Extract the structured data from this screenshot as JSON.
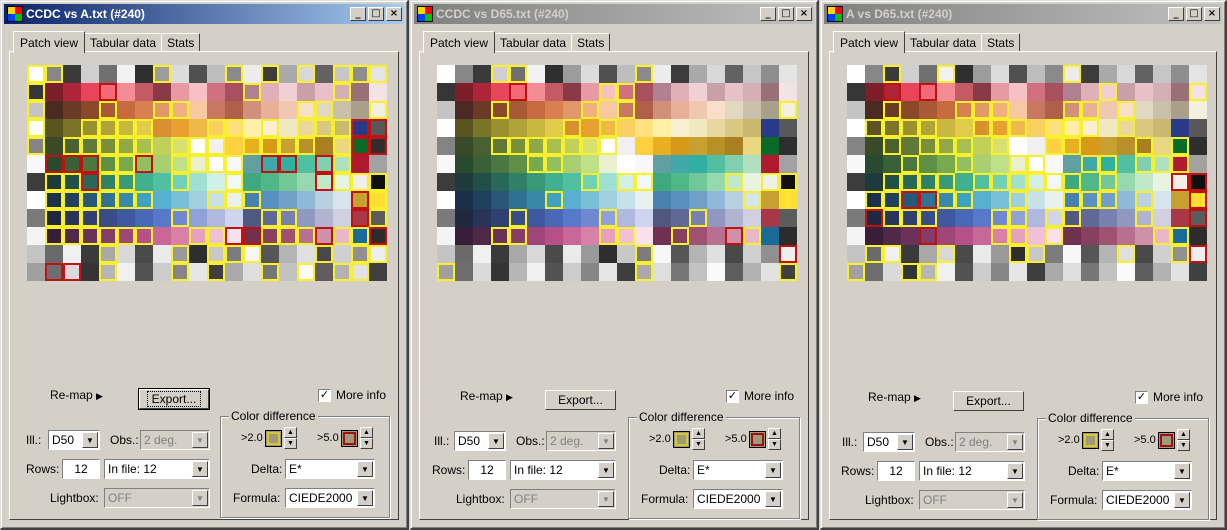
{
  "colors": {
    "patch_rows": [
      [
        "#ffffff",
        "#878787",
        "#3a3a3a",
        "#cfcfcf",
        "#6f6f6f",
        "#f2f2f2",
        "#2f2f2f",
        "#9c9c9c",
        "#dcdcdc",
        "#505050",
        "#bdbdbd",
        "#8a8a8a",
        "#ececec",
        "#3c3c3c",
        "#a9a9a9",
        "#d8d8d8",
        "#626262",
        "#c6c6c6",
        "#8e8e8e",
        "#e4e4e4"
      ],
      [
        "#363636",
        "#7b1e2a",
        "#b0243a",
        "#e8455a",
        "#f26a78",
        "#f48c94",
        "#c45a64",
        "#8a3a46",
        "#e89aa4",
        "#f7c0c4",
        "#d07080",
        "#a85060",
        "#b08090",
        "#e0b0b8",
        "#f0d0d4",
        "#c8a0a8",
        "#e8c0c8",
        "#d4b0b4",
        "#9a7078",
        "#f2e4e4"
      ],
      [
        "#c4c4c4",
        "#4a2a22",
        "#6a3a26",
        "#8a4a2a",
        "#a85a36",
        "#c86a40",
        "#d88050",
        "#e09868",
        "#f0b080",
        "#f8c8a0",
        "#c87860",
        "#b06048",
        "#d0907a",
        "#e8b098",
        "#f0c8b0",
        "#f8e0c8",
        "#e0d8c0",
        "#c8c0a8",
        "#a8a088",
        "#f4f0e0"
      ],
      [
        "#ffffff",
        "#5a5420",
        "#7a7428",
        "#9a9030",
        "#b0a438",
        "#c8b840",
        "#e0cc48",
        "#d89030",
        "#e8a030",
        "#f0b848",
        "#f8d060",
        "#ffe080",
        "#fff0a8",
        "#f8f0d0",
        "#f0e8c0",
        "#e8d8a0",
        "#d8c880",
        "#c8b870",
        "#2a3a8a",
        "#585858"
      ],
      [
        "#848484",
        "#3a4a28",
        "#4a6030",
        "#607838",
        "#78903e",
        "#90a848",
        "#a8c050",
        "#c0d058",
        "#d8e070",
        "#ffffff",
        "#f0f0f0",
        "#ffd040",
        "#e8b020",
        "#d89818",
        "#c8a030",
        "#b89028",
        "#a88020",
        "#e8d880",
        "#0a6a2a",
        "#2e2e2e"
      ],
      [
        "#f8f8f8",
        "#2a4a30",
        "#3a6038",
        "#4a7840",
        "#609048",
        "#78a850",
        "#90c060",
        "#a8d070",
        "#c0e088",
        "#e8f0d0",
        "#ffffff",
        "#f8f8f8",
        "#60a0a0",
        "#40a8a8",
        "#30b0a0",
        "#50c0a0",
        "#80d0b0",
        "#b0e0c0",
        "#b01a30",
        "#a2a2a2"
      ],
      [
        "#3c3c3c",
        "#1e3a3a",
        "#205048",
        "#286858",
        "#308068",
        "#389878",
        "#40b090",
        "#50c0a0",
        "#70d0b8",
        "#a0e0d0",
        "#d0f0e8",
        "#f0f8f8",
        "#40a880",
        "#50b888",
        "#70c898",
        "#98d8b0",
        "#c0e8c8",
        "#e8f4e0",
        "#f0f0e8",
        "#101010"
      ],
      [
        "#ffffff",
        "#1a3048",
        "#204060",
        "#285878",
        "#307090",
        "#3888a8",
        "#40a0c0",
        "#58b0d0",
        "#78c0d8",
        "#a0d0e0",
        "#c8e0e8",
        "#e8f0f0",
        "#4880b0",
        "#5890c0",
        "#70a0c8",
        "#90b8d8",
        "#b8d0e0",
        "#d8e4ec",
        "#c8a030",
        "#ffe030"
      ],
      [
        "#7a7a7a",
        "#202840",
        "#283458",
        "#304070",
        "#384c88",
        "#4058a0",
        "#4a68b8",
        "#5878c8",
        "#7088d0",
        "#90a0d8",
        "#b0b8e0",
        "#d0d4ec",
        "#505880",
        "#606898",
        "#7880b0",
        "#9098c0",
        "#b0b4d0",
        "#d0d0e0",
        "#a83848",
        "#5c5c5c"
      ],
      [
        "#f4f4f4",
        "#381e38",
        "#502848",
        "#6a3258",
        "#843c68",
        "#9e4678",
        "#b85088",
        "#c86898",
        "#d880a8",
        "#e8a0c0",
        "#f0c0d4",
        "#f8e0ec",
        "#703050",
        "#884060",
        "#a05070",
        "#b87090",
        "#d090a8",
        "#e8b8c8",
        "#1a6a9a",
        "#2c2c2c"
      ],
      [
        "#c4c4c4",
        "#6a6a6a",
        "#f0f0f0",
        "#3a3a3a",
        "#a8a8a8",
        "#d8d8d8",
        "#4a4a4a",
        "#eaeaea",
        "#9a9a9a",
        "#2e2e2e",
        "#c8c8c8",
        "#7c7c7c",
        "#f6f6f6",
        "#565656",
        "#b4b4b4",
        "#e0e0e0",
        "#484848",
        "#d0d0d0",
        "#909090",
        "#eeeeee"
      ],
      [
        "#a0a0a0",
        "#6e6e6e",
        "#dadada",
        "#343434",
        "#b6b6b6",
        "#f0f0f0",
        "#525252",
        "#cccccc",
        "#868686",
        "#e6e6e6",
        "#3e3e3e",
        "#aaaaaa",
        "#dedede",
        "#767676",
        "#c2c2c2",
        "#fafafa",
        "#5e5e5e",
        "#b2b2b2",
        "#e2e2e2",
        "#404040"
      ]
    ]
  },
  "windows": [
    {
      "title": "CCDC vs A.txt (#240)",
      "active": true,
      "tabs": [
        "Patch view",
        "Tabular data",
        "Stats"
      ],
      "remap_label": "Re-map",
      "export_label": "Export...",
      "more_info_label": "More info",
      "more_info_checked": "✓",
      "ill_label": "Ill.:",
      "ill_value": "D50",
      "obs_label": "Obs.:",
      "obs_value": "2 deg.",
      "rows_label": "Rows:",
      "rows_value": "12",
      "in_file_value": "In file: 12",
      "lightbox_label": "Lightbox:",
      "lightbox_value": "OFF",
      "color_diff_title": "Color difference",
      "gt2_label": ">2.0",
      "gt5_label": ">5.0",
      "delta_label": "Delta:",
      "delta_value": "E*",
      "formula_label": "Formula:",
      "formula_value": "CIEDE2000"
    },
    {
      "title": "CCDC vs D65.txt (#240)",
      "active": false,
      "tabs": [
        "Patch view",
        "Tabular data",
        "Stats"
      ],
      "remap_label": "Re-map",
      "export_label": "Export...",
      "more_info_label": "More info",
      "more_info_checked": "✓",
      "ill_label": "Ill.:",
      "ill_value": "D50",
      "obs_label": "Obs.:",
      "obs_value": "2 deg.",
      "rows_label": "Rows:",
      "rows_value": "12",
      "in_file_value": "In file: 12",
      "lightbox_label": "Lightbox:",
      "lightbox_value": "OFF",
      "color_diff_title": "Color difference",
      "gt2_label": ">2.0",
      "gt5_label": ">5.0",
      "delta_label": "Delta:",
      "delta_value": "E*",
      "formula_label": "Formula:",
      "formula_value": "CIEDE2000"
    },
    {
      "title": "A vs D65.txt (#240)",
      "active": false,
      "tabs": [
        "Patch view",
        "Tabular data",
        "Stats"
      ],
      "remap_label": "Re-map",
      "export_label": "Export...",
      "more_info_label": "More info",
      "more_info_checked": "✓",
      "ill_label": "Ill.:",
      "ill_value": "D50",
      "obs_label": "Obs.:",
      "obs_value": "2 deg.",
      "rows_label": "Rows:",
      "rows_value": "12",
      "in_file_value": "In file: 12",
      "lightbox_label": "Lightbox:",
      "lightbox_value": "OFF",
      "color_diff_title": "Color difference",
      "gt2_label": ">2.0",
      "gt5_label": ">5.0",
      "delta_label": "Delta:",
      "delta_value": "E*",
      "formula_label": "Formula:",
      "formula_value": "CIEDE2000"
    }
  ],
  "title_buttons": {
    "minimize": "_",
    "maximize": "□",
    "close": "×"
  },
  "highlights": [
    "yy.....y...y.y.y.yyy|y...r.......y....y..|y...y..yy......yy..y|y..yyyy...yy.y.yyyrr|y.yyyyy.yyy.yyyy.yrr|.rrryyr.yyyy.rr.ry..|.yyryy..y..y....ryyy|.yyyyyy...yyy.....ry|.yyy....y....yy...ry|.yyyyyy..yyrryyyryyr|....y...y.yyy...y.yy|.rr.y...y.y..y.y.yy.",
    "...yy......y........|....r....yy.........|...y....y.y........y|.......y.y..........|...yyyyyyy..........|.....yy.............|........y.yy....y.yy|......y..........y..|....y....y....y.....|...yy....yy..y..ry..|...........y.......r|y..........y.......y.",
    "..y..y......y.......|..r.r.........y....y|..y...yyy...yy.y....|.yyyy..yyy.yyy.y....|..y.yyy.y..yy...y.y.|...y..y..yy..yy.yyy.|..yyyy.yyyyyy.y...rr|.yyrryy..y..yyy.y..r|.ryyy...yy.yy...y..r|....r...yy.y.....yy.|.yy..y...yy....y..yr|y..yy...............",
    "...........y........|..y..................|....................|.y.y....y...y.y.y..y|....................|........r.......yy..|...yyy..y...y..r..yr|.y.rrr...y.......y..|.y.yyy.y..yy.ry...y.|....................|..y.yyyyy...........|..r.y.yy...y.y.....y"
  ]
}
